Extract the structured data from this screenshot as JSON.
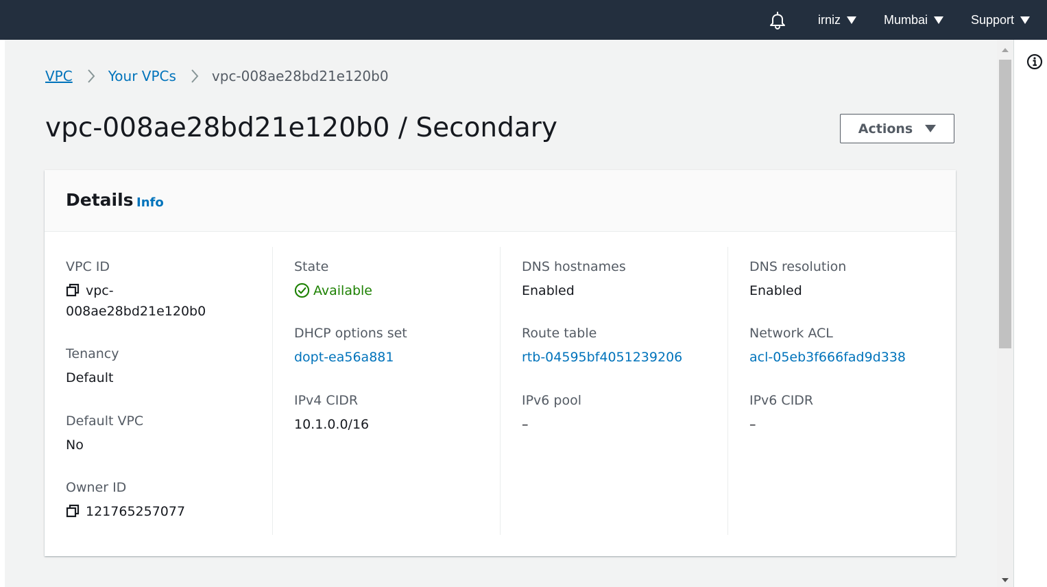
{
  "topbar": {
    "user": "irniz",
    "region": "Mumbai",
    "support": "Support"
  },
  "breadcrumb": {
    "root": "VPC",
    "parent": "Your VPCs",
    "current": "vpc-008ae28bd21e120b0"
  },
  "page": {
    "title": "vpc-008ae28bd21e120b0 / Secondary",
    "actions_label": "Actions"
  },
  "details": {
    "title": "Details",
    "info_link": "Info",
    "col1": {
      "vpc_id_label": "VPC ID",
      "vpc_id_line1": "vpc-",
      "vpc_id_line2": "008ae28bd21e120b0",
      "tenancy_label": "Tenancy",
      "tenancy_value": "Default",
      "default_vpc_label": "Default VPC",
      "default_vpc_value": "No",
      "owner_id_label": "Owner ID",
      "owner_id_value": "121765257077"
    },
    "col2": {
      "state_label": "State",
      "state_value": "Available",
      "dhcp_label": "DHCP options set",
      "dhcp_value": "dopt-ea56a881",
      "ipv4_label": "IPv4 CIDR",
      "ipv4_value": "10.1.0.0/16"
    },
    "col3": {
      "dns_hostnames_label": "DNS hostnames",
      "dns_hostnames_value": "Enabled",
      "route_table_label": "Route table",
      "route_table_value": "rtb-04595bf4051239206",
      "ipv6_pool_label": "IPv6 pool",
      "ipv6_pool_value": "–"
    },
    "col4": {
      "dns_resolution_label": "DNS resolution",
      "dns_resolution_value": "Enabled",
      "acl_label": "Network ACL",
      "acl_value": "acl-05eb3f666fad9d338",
      "ipv6_cidr_label": "IPv6 CIDR",
      "ipv6_cidr_value": "–"
    }
  },
  "colors": {
    "topbar_bg": "#232f3e",
    "link": "#0073bb",
    "success": "#1d8102",
    "page_bg": "#f2f3f3"
  },
  "icons": [
    "bell-icon",
    "copy-icon",
    "status-available-icon",
    "info-circle-icon"
  ]
}
